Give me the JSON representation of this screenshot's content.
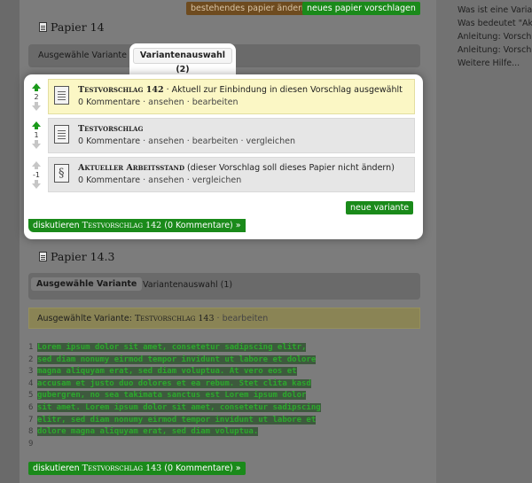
{
  "header": {
    "btn_change": "bestehendes papier ändern",
    "btn_propose": "neues papier vorschlagen"
  },
  "paper1": {
    "title": "Papier 14",
    "tab_selected": "Ausgewähle Variante",
    "tab_variants": "Variantenauswahl (2)",
    "rows": [
      {
        "votes": "2",
        "title": "Testvorschlag 142",
        "desc": " · Aktuell zur Einbindung in diesen Vorschlag ausgewählt",
        "comments": "0 Kommentare",
        "links": " · ansehen · bearbeiten"
      },
      {
        "votes": "1",
        "title": "Testvorschlag",
        "desc": "",
        "comments": "0 Kommentare",
        "links": " · ansehen · bearbeiten · vergleichen"
      },
      {
        "votes": "-1",
        "title": "Aktueller Arbeitsstand",
        "desc": " (dieser Vorschlag soll dieses Papier nicht ändern)",
        "comments": "0 Kommentare",
        "links": " · ansehen · vergleichen"
      }
    ],
    "new_variant": "neue variante",
    "discuss_prefix": "diskutieren ",
    "discuss_title": "Testvorschlag 142",
    "discuss_suffix": " (0 Kommentare) »"
  },
  "paper2": {
    "title": "Papier 14.3",
    "tab_selected": "Ausgewähle Variante",
    "tab_variants": "Variantenauswahl (1)",
    "sel_prefix": "Ausgewählte Variante: ",
    "sel_title": "Testvorschlag 143",
    "sel_suffix": " · bearbeiten",
    "code_lines": [
      "Lorem ipsum dolor sit amet, consetetur sadipscing elitr,",
      "sed diam nonumy eirmod tempor invidunt ut labore et dolore",
      "magna aliquyam erat, sed diam voluptua. At vero eos et",
      "accusam et justo duo dolores et ea rebum. Stet clita kasd",
      "gubergren, no sea takimata sanctus est Lorem ipsum dolor",
      "sit amet. Lorem ipsum dolor sit amet, consetetur sadipscing",
      "elitr, sed diam nonumy eirmod tempor invidunt ut labore et",
      "dolore magna aliquyam erat, sed diam voluptua.",
      ""
    ],
    "discuss_prefix": "diskutieren ",
    "discuss_title": "Testvorschlag 143",
    "discuss_suffix": " (0 Kommentare) »"
  },
  "sidebar": {
    "items": [
      "Was ist eine Variante?",
      "Was bedeutet \"Aktueller Arbeitsstand\"?",
      "Anleitung: Vorschlag erstellen",
      "Anleitung: Vorschlag bearbeiten",
      "Weitere Hilfe..."
    ]
  }
}
